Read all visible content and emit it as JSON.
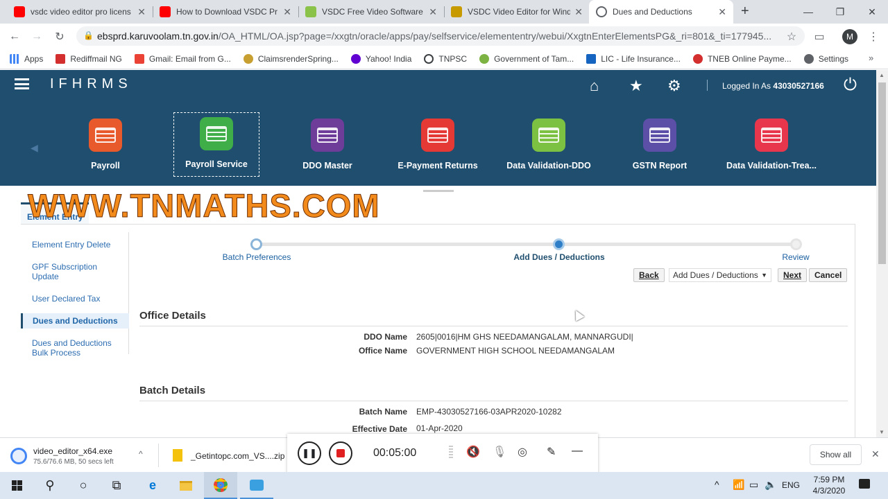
{
  "browser": {
    "tabs": [
      {
        "title": "vsdc video editor pro licens",
        "color": "#ff0000"
      },
      {
        "title": "How to Download VSDC Pr",
        "color": "#ff0000"
      },
      {
        "title": "VSDC Free Video Software",
        "color": "#8bc34a"
      },
      {
        "title": "VSDC Video Editor for Wind",
        "color": "#c79a00"
      },
      {
        "title": "Dues and Deductions",
        "color": "#5f6368"
      }
    ],
    "url_host": "ebsprd.karuvoolam.tn.gov.in",
    "url_path": "/OA_HTML/OA.jsp?page=/xxgtn/oracle/apps/pay/selfservice/elemententry/webui/XxgtnEnterElementsPG&_ri=801&_ti=177945...",
    "profile_initial": "M",
    "bookmarks": [
      {
        "label": "Apps",
        "color": "#4285f4"
      },
      {
        "label": "Rediffmail NG",
        "color": "#d32f2f"
      },
      {
        "label": "Gmail: Email from G...",
        "color": "#ea4335"
      },
      {
        "label": "ClaimsrenderSpring...",
        "color": "#c8a032"
      },
      {
        "label": "Yahoo! India",
        "color": "#6001d2"
      },
      {
        "label": "TNPSC",
        "color": "#3c4043"
      },
      {
        "label": "Government of Tam...",
        "color": "#7cb342"
      },
      {
        "label": "LIC - Life Insurance...",
        "color": "#1565c0"
      },
      {
        "label": "TNEB Online Payme...",
        "color": "#d32f2f"
      },
      {
        "label": "Settings",
        "color": "#5f6368"
      }
    ]
  },
  "app": {
    "logo": "IFHRMS",
    "logged_in_prefix": "Logged In As",
    "user_id": "43030527166",
    "tiles": [
      {
        "label": "Payroll",
        "color": "#e8592c"
      },
      {
        "label": "Payroll Service",
        "color": "#3fae49"
      },
      {
        "label": "DDO Master",
        "color": "#6e3c99"
      },
      {
        "label": "E-Payment Returns",
        "color": "#e53935"
      },
      {
        "label": "Data Validation-DDO",
        "color": "#7cc142"
      },
      {
        "label": "GSTN Report",
        "color": "#5c4fa8"
      },
      {
        "label": "Data Validation-Trea...",
        "color": "#e8374d"
      }
    ],
    "watermark": "WWW.TNMATHS.COM",
    "section_tab": "Element Entry",
    "left_nav": [
      "Element Entry Delete",
      "GPF Subscription Update",
      "User Declared Tax",
      "Dues and Deductions",
      "Dues and Deductions Bulk Process"
    ],
    "train": [
      "Batch Preferences",
      "Add Dues / Deductions",
      "Review"
    ],
    "buttons": {
      "back": "Back",
      "select": "Add Dues / Deductions",
      "next": "Next",
      "cancel": "Cancel"
    },
    "office": {
      "heading": "Office Details",
      "ddo_label": "DDO Name",
      "ddo_value": "2605|0016|HM GHS NEEDAMANGALAM, MANNARGUDI|",
      "office_label": "Office Name",
      "office_value": "GOVERNMENT HIGH SCHOOL NEEDAMANGALAM"
    },
    "batch": {
      "heading": "Batch Details",
      "name_label": "Batch Name",
      "name_value": "EMP-43030527166-03APR2020-10282",
      "date_label": "Effective Date",
      "date_value": "01-Apr-2020"
    }
  },
  "downloads": [
    {
      "name": "video_editor_x64.exe",
      "status": "75.6/76.6 MB, 50 secs left"
    },
    {
      "name": "_Getintopc.com_VS....zip",
      "status": ""
    }
  ],
  "recorder_time": "00:05:00",
  "show_all": "Show all",
  "taskbar": {
    "time": "7:59 PM",
    "date": "4/3/2020",
    "lang": "ENG"
  }
}
